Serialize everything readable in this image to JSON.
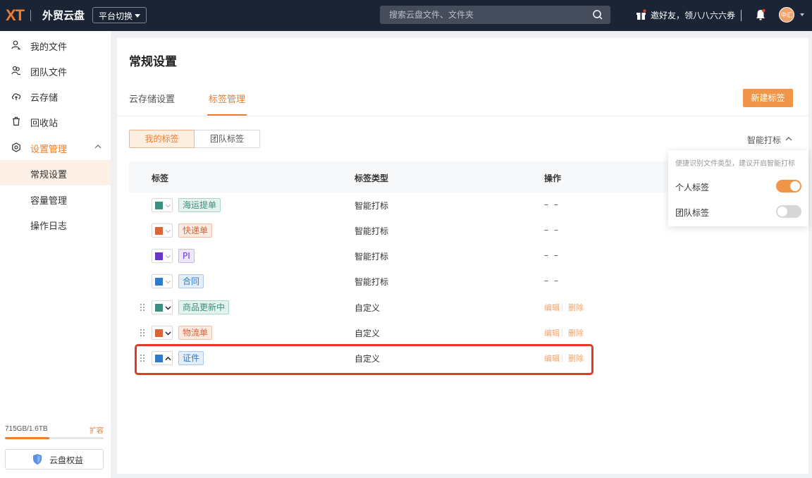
{
  "header": {
    "logo": "XT",
    "app_name": "外贸云盘",
    "platform_switch": "平台切换",
    "search_placeholder": "搜索云盘文件、文件夹",
    "invite_text": "邀好友，领八八六六券",
    "avatar_text": "中汇"
  },
  "sidebar": {
    "items": [
      {
        "label": "我的文件",
        "icon": "user-file-icon"
      },
      {
        "label": "团队文件",
        "icon": "team-file-icon"
      },
      {
        "label": "云存储",
        "icon": "cloud-storage-icon"
      },
      {
        "label": "回收站",
        "icon": "trash-icon"
      },
      {
        "label": "设置管理",
        "icon": "settings-icon",
        "expanded": true
      }
    ],
    "sub_items": [
      {
        "label": "常规设置",
        "active": true
      },
      {
        "label": "容量管理"
      },
      {
        "label": "操作日志"
      }
    ],
    "storage_text": "715GB/1.6TB",
    "storage_used_fraction": 0.45,
    "expand_link": "扩容",
    "rights_button": "云盘权益"
  },
  "main": {
    "title": "常规设置",
    "tabs": [
      {
        "label": "云存储设置",
        "active": false
      },
      {
        "label": "标签管理",
        "active": true
      }
    ],
    "new_tag_button": "新建标签",
    "segments": [
      {
        "label": "我的标签",
        "active": true
      },
      {
        "label": "团队标签",
        "active": false
      }
    ],
    "smart_tagging_label": "智能打标",
    "table": {
      "headers": [
        "标签",
        "标签类型",
        "操作"
      ],
      "rows": [
        {
          "color": "#3b8f7e",
          "tag": "海运提单",
          "tag_bg": "#e5f3ee",
          "tag_border": "#a9d6c8",
          "tag_fg": "#3b8f7e",
          "type": "智能打标",
          "action": "– –",
          "draggable": false
        },
        {
          "color": "#d9663b",
          "tag": "快递单",
          "tag_bg": "#fbeae1",
          "tag_border": "#f0bea6",
          "tag_fg": "#d9663b",
          "type": "智能打标",
          "action": "– –",
          "draggable": false
        },
        {
          "color": "#6c35c9",
          "tag": "PI",
          "tag_bg": "#eee6fa",
          "tag_border": "#c8b2ef",
          "tag_fg": "#6c35c9",
          "type": "智能打标",
          "action": "– –",
          "draggable": false
        },
        {
          "color": "#2f7bc9",
          "tag": "合同",
          "tag_bg": "#e4eef9",
          "tag_border": "#a9c8ea",
          "tag_fg": "#2f7bc9",
          "type": "智能打标",
          "action": "– –",
          "draggable": false
        },
        {
          "color": "#3b8f7e",
          "tag": "商品更新中",
          "tag_bg": "#e5f3ee",
          "tag_border": "#a9d6c8",
          "tag_fg": "#3b8f7e",
          "type": "自定义",
          "edit": "编辑",
          "delete": "删除",
          "draggable": true,
          "open": false
        },
        {
          "color": "#d9663b",
          "tag": "物流单",
          "tag_bg": "#fbeae1",
          "tag_border": "#f0bea6",
          "tag_fg": "#d9663b",
          "type": "自定义",
          "edit": "编辑",
          "delete": "删除",
          "draggable": true,
          "open": false
        },
        {
          "color": "#2f7bc9",
          "tag": "证件",
          "tag_bg": "#e4eef9",
          "tag_border": "#a9c8ea",
          "tag_fg": "#2f7bc9",
          "type": "自定义",
          "edit": "编辑",
          "delete": "删除",
          "draggable": true,
          "open": true
        }
      ]
    }
  },
  "popover": {
    "hint": "便捷识别文件类型，建议开启智能打标",
    "options": [
      {
        "label": "个人标签",
        "on": true
      },
      {
        "label": "团队标签",
        "on": false
      }
    ]
  },
  "colors": {
    "accent": "#ef7d2e",
    "header_bg": "#1b2434",
    "highlight": "#e03b24"
  }
}
